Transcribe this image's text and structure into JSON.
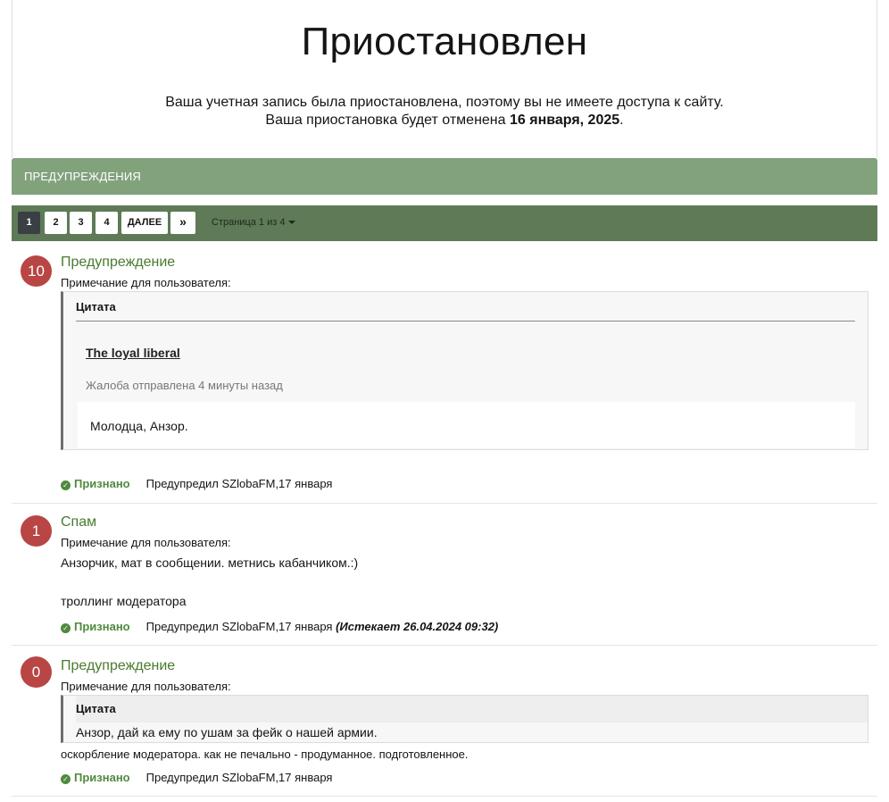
{
  "suspension": {
    "title": "Приостановлен",
    "line1": "Ваша учетная запись была приостановлена, поэтому вы не имеете доступа к сайту.",
    "line2_prefix": "Ваша приостановка будет отменена ",
    "line2_date": "16 января, 2025",
    "line2_suffix": "."
  },
  "warnings_header": "Предупреждения",
  "pagination": {
    "pages": [
      "1",
      "2",
      "3",
      "4"
    ],
    "current": "1",
    "next_label": "ДАЛЕЕ",
    "last_label": "»",
    "page_info": "Страница 1 из 4"
  },
  "warnings": [
    {
      "points": "10",
      "title": "Предупреждение",
      "note_label": "Примечание для пользователя:",
      "quote": {
        "header": "Цитата",
        "link": "The loyal liberal",
        "meta": "Жалоба отправлена 4 минуты назад",
        "text": "Молодца, Анзор."
      },
      "status": "Признано",
      "by": "Предупредил SZlobaFM,17 января"
    },
    {
      "points": "1",
      "title": "Спам",
      "note_label": "Примечание для пользователя:",
      "text_line1": "Анзорчик, мат в сообщении. метнись кабанчиком.:)",
      "text_line2": "троллинг модератора",
      "status": "Признано",
      "by": "Предупредил SZlobaFM,17 января",
      "expires": "(Истекает 26.04.2024 09:32)"
    },
    {
      "points": "0",
      "title": "Предупреждение",
      "note_label": "Примечание для пользователя:",
      "quote": {
        "header": "Цитата",
        "text": "Анзор, дай ка ему по ушам за фейк о нашей армии."
      },
      "after_quote": "оскорбление модератора. как не печально - продуманное. подготовленное.",
      "status": "Признано",
      "by": "Предупредил SZlobaFM,17 января"
    }
  ],
  "colors": {
    "header_bg": "#82a27c",
    "pager_bg": "#5e7a57",
    "badge_bg": "#b94545",
    "title_color": "#4a7a2f",
    "acknowledged": "#4f8a3e"
  }
}
